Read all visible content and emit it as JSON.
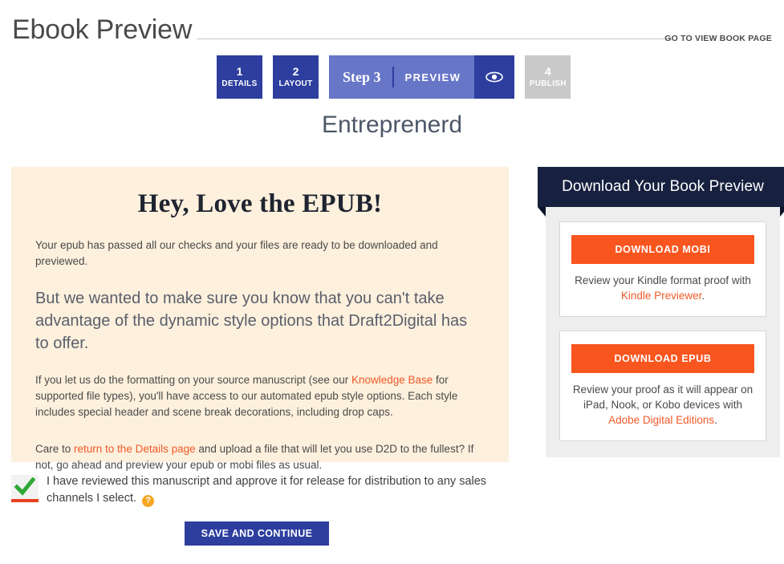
{
  "header": {
    "title": "Ebook Preview",
    "view_book_link": "GO TO VIEW BOOK PAGE"
  },
  "steps": {
    "completed": [
      {
        "num": "1",
        "label": "DETAILS"
      },
      {
        "num": "2",
        "label": "LAYOUT"
      }
    ],
    "current": {
      "step_label": "Step 3",
      "name": "PREVIEW",
      "icon": "eye-icon"
    },
    "upcoming": [
      {
        "num": "4",
        "label": "PUBLISH"
      }
    ]
  },
  "book": {
    "title": "Entreprenerd"
  },
  "notice": {
    "heading": "Hey, Love the EPUB!",
    "intro": "Your epub has passed all our checks and your files are ready to be downloaded and previewed.",
    "lead": "But we wanted to make sure you know that you can't take advantage of the dynamic style options that Draft2Digital has to offer.",
    "body_part1": "If you let us do the formatting on your source manuscript (see our ",
    "body_link1": "Knowledge Base",
    "body_part2": " for supported file types), you'll have access to our automated epub style options. Each style includes special header and scene break decorations, including drop caps.",
    "closing_part1": "Care to ",
    "closing_link": "return to the Details page",
    "closing_part2": " and upload a file that will let you use D2D to the fullest? If not, go ahead and preview your epub or mobi files as usual."
  },
  "download": {
    "panel_title": "Download Your Book Preview",
    "cards": [
      {
        "button_label": "DOWNLOAD MOBI",
        "caption_part1": "Review your Kindle format proof with ",
        "caption_link": "Kindle Previewer",
        "caption_part2": "."
      },
      {
        "button_label": "DOWNLOAD EPUB",
        "caption_part1": "Review your proof as it will appear on iPad, Nook, or Kobo devices with ",
        "caption_link": "Adobe Digital Editions",
        "caption_part2": "."
      }
    ]
  },
  "approval": {
    "checked": true,
    "text": "I have reviewed this manuscript and approve it for release for distribution to any sales channels I select.",
    "help_glyph": "?"
  },
  "actions": {
    "save_label": "SAVE AND CONTINUE"
  },
  "colors": {
    "primary_navy": "#2d3e9e",
    "step_current": "#6776c7",
    "ribbon_navy": "#17203f",
    "accent_orange": "#f9551f",
    "link_orange": "#f05a28",
    "panel_beige": "#fdf0dd",
    "inactive_gray": "#c9c9c9",
    "check_green": "#2ea836",
    "help_amber": "#f5a623"
  }
}
